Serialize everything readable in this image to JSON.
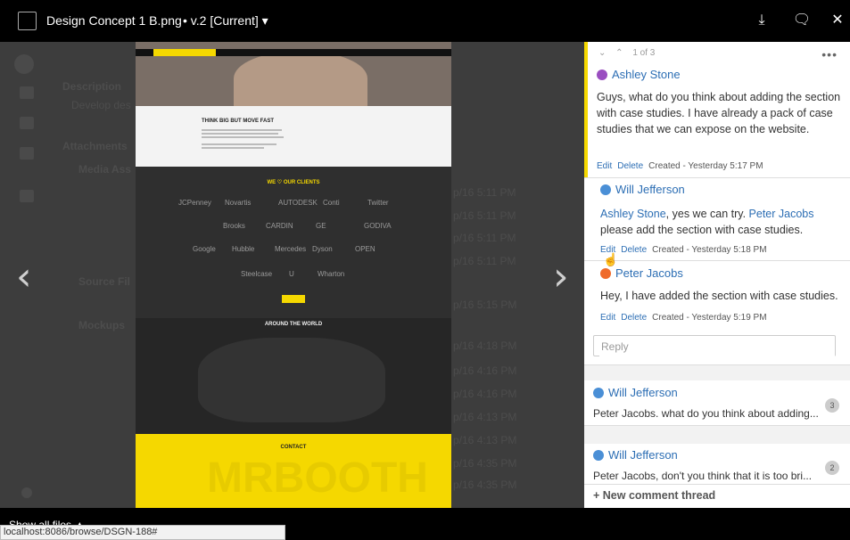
{
  "header": {
    "file_name": "Design Concept 1 B.png",
    "version": "• v.2 [Current] ▾",
    "download_icon": "⤓",
    "comment_icon": "🗨",
    "close_icon": "✕"
  },
  "background": {
    "description_label": "Description",
    "description_text": "Develop des",
    "attachments_label": "Attachments",
    "media_label": "Media Ass",
    "source_label": "Source Fil",
    "mockups_label": "Mockups",
    "timestamps": [
      "p/16 5:11 PM",
      "p/16 5:11 PM",
      "p/16 5:11 PM",
      "p/16 5:11 PM",
      "p/16 5:15 PM",
      "p/16 4:18 PM",
      "p/16 4:16 PM",
      "p/16 4:16 PM",
      "p/16 4:13 PM",
      "p/16 4:13 PM",
      "p/16 4:35 PM",
      "p/16 4:35 PM"
    ]
  },
  "preview": {
    "headline": "THINK BIG BUT MOVE FAST",
    "clients_heading": "WE ♡ OUR CLIENTS",
    "world_heading": "AROUND THE WORLD",
    "contact_heading": "CONTACT",
    "watermark": "MRBOOTH",
    "client_logos": [
      "JCPenney",
      "Novartis",
      "AUTODESK",
      "Conti",
      "Twitter",
      "Brooks",
      "CARDIN",
      "GE",
      "GODIVA",
      "Google",
      "Hubble",
      "Mercedes",
      "Dyson",
      "OPEN",
      "Steelcase",
      "U",
      "Wharton"
    ]
  },
  "navigation": {
    "prev_arrow": "‹",
    "next_arrow": "›"
  },
  "comments": {
    "nav_up": "⌄",
    "nav_down": "⌃",
    "counter": "1 of 3",
    "more": "•••",
    "items": [
      {
        "author": "Ashley Stone",
        "body": "Guys, what do you think about adding the section with case studies. I have already a pack of case studies that we can expose on the website.",
        "edit": "Edit",
        "delete": "Delete",
        "created": "Created - Yesterday 5:17 PM"
      },
      {
        "author": "Will Jefferson",
        "mention1": "Ashley Stone",
        "text1": ", yes we can try. ",
        "mention2": "Peter Jacobs",
        "text2": " please add the section with case studies.",
        "edit": "Edit",
        "delete": "Delete",
        "created": "Created - Yesterday 5:18 PM"
      },
      {
        "author": "Peter Jacobs",
        "body": "Hey, I have added the section with case studies.",
        "edit": "Edit",
        "delete": "Delete",
        "created": "Created - Yesterday 5:19 PM"
      }
    ],
    "reply_placeholder": "Reply",
    "threads": [
      {
        "author": "Will Jefferson",
        "preview": "Peter Jacobs. what do you think about adding...",
        "count": "3"
      },
      {
        "author": "Will Jefferson",
        "preview": "Peter Jacobs, don't you think that it is too bri...",
        "count": "2"
      }
    ],
    "new_thread": "+ New comment thread"
  },
  "footer": {
    "show_all": "Show all files ▲",
    "status_url": "localhost:8086/browse/DSGN-188#"
  },
  "colors": {
    "accent_yellow": "#f5d800",
    "link_blue": "#2c6eb4"
  }
}
